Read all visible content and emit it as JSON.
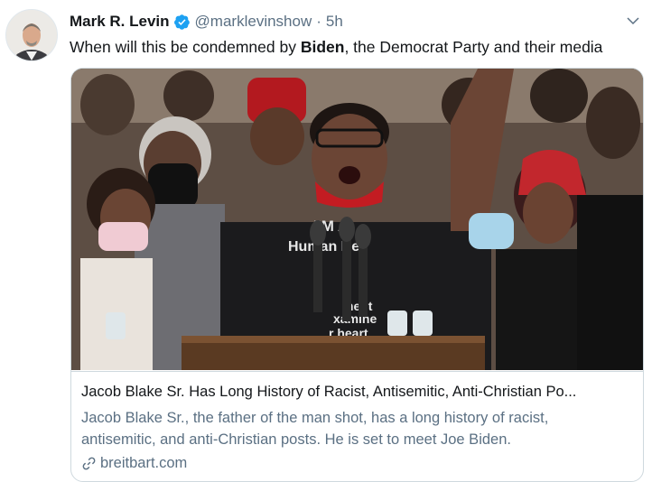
{
  "author": {
    "name": "Mark R. Levin",
    "handle": "@marklevinshow",
    "separator": "·",
    "time": "5h"
  },
  "tweet": {
    "text_before": "When will this be condemned by ",
    "text_bold": "Biden",
    "text_after": ", the Democrat Party and their media"
  },
  "card": {
    "title": "Jacob Blake Sr. Has Long History of Racist, Antisemitic, Anti-Christian Po...",
    "description": "Jacob Blake Sr., the father of the man shot, has a long history of racist, antisemitic, and anti-Christian posts. He is set to meet Joe Biden.",
    "domain": "breitbart.com",
    "image_sign_text": [
      "I'M A",
      "Human Be",
      "ment",
      "xamine",
      "r heart"
    ]
  },
  "colors": {
    "verified": "#1da1f2",
    "secondary_text": "#5b7083",
    "border": "#cfd9de"
  },
  "icons": {
    "verified": "verified-badge-icon",
    "menu": "chevron-down-icon",
    "link": "link-icon"
  }
}
